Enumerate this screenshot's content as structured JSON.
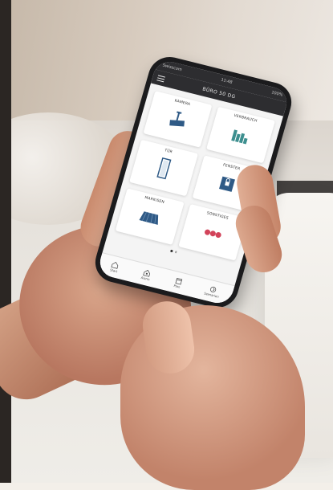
{
  "status_bar": {
    "left": "Swisscom",
    "center": "11:48",
    "right": "100%"
  },
  "app_bar": {
    "title": "BÜRO 50 DG"
  },
  "tiles": [
    {
      "label": "KAMERA",
      "icon": "camera-icon"
    },
    {
      "label": "VERBRAUCH",
      "icon": "bar-chart-icon"
    },
    {
      "label": "TÜR",
      "icon": "door-icon"
    },
    {
      "label": "FENSTER",
      "icon": "window-lock-icon"
    },
    {
      "label": "MARKISEN",
      "icon": "awning-icon"
    },
    {
      "label": "SONSTIGES",
      "icon": "three-dots-icon"
    }
  ],
  "tabs": [
    {
      "label": "Start",
      "icon": "home-icon"
    },
    {
      "label": "Alarm",
      "icon": "alarm-house-icon"
    },
    {
      "label": "Plan",
      "icon": "calendar-icon"
    },
    {
      "label": "Szenarien",
      "icon": "scenes-icon"
    }
  ],
  "colors": {
    "app_bar": "#2d2d30",
    "tile_icon_blue": "#2f5a86",
    "tile_icon_teal": "#3d8f8f",
    "dots_red": "#d2435a"
  }
}
